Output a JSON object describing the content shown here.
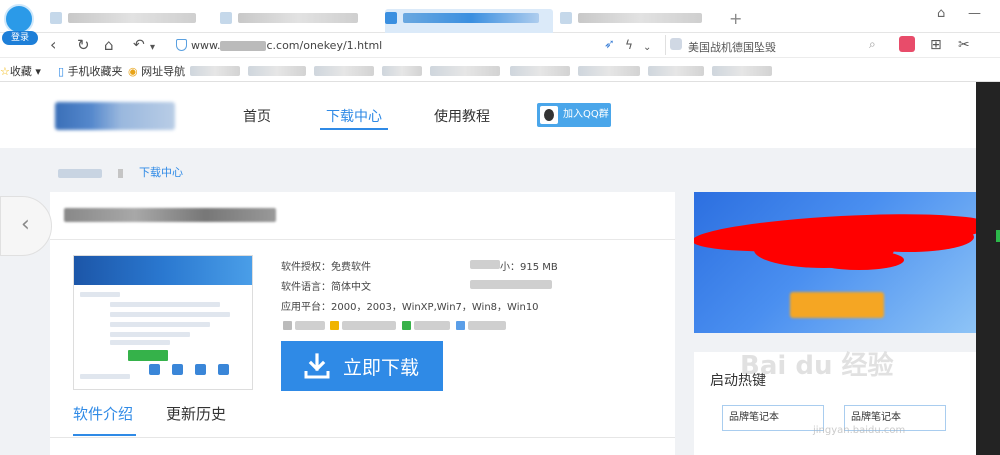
{
  "browser": {
    "login_label": "登录",
    "new_tab_symbol": "+",
    "url_prefix": "www.",
    "url_suffix": "c.com/onekey/1.html",
    "search_text": "美国战机德国坠毁",
    "bookmarks": {
      "favorites_label": "收藏",
      "mobile_favorites_label": "手机收藏夹",
      "site_nav_label": "网址导航"
    }
  },
  "site": {
    "nav": [
      {
        "label": "首页"
      },
      {
        "label": "下载中心"
      },
      {
        "label": "使用教程"
      }
    ],
    "qq_group_label": "加入QQ群",
    "breadcrumb_current": "下载中心"
  },
  "software": {
    "license": "软件授权：免费软件",
    "size_label_tail": "小：915 MB",
    "language": "软件语言：简体中文",
    "platform": "应用平台：2000，2003，WinXP,Win7，Win8，Win10",
    "download_label": "立即下载",
    "tabs": [
      {
        "label": "软件介绍"
      },
      {
        "label": "更新历史"
      }
    ]
  },
  "sidebar": {
    "hot_title": "启动热键",
    "hot_tags": [
      {
        "label": "品牌笔记本"
      },
      {
        "label": "品牌笔记本"
      }
    ]
  },
  "watermark": {
    "text": "Bai du 经验",
    "sub": "jingyan.baidu.com"
  },
  "colors": {
    "accent": "#2f8ae6",
    "download_button": "#2f8ae6",
    "banner_start": "#2c6fe0",
    "redaction": "#ff0000"
  }
}
